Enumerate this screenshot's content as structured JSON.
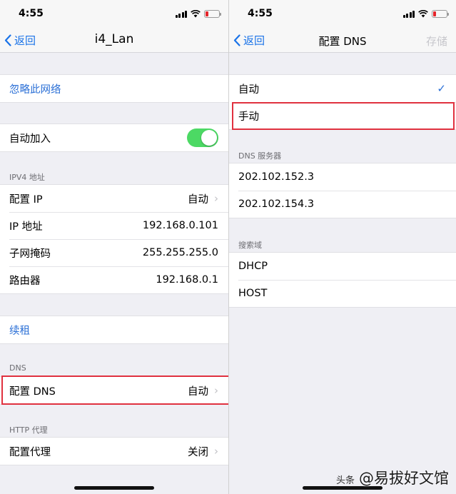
{
  "left": {
    "status": {
      "time": "4:55"
    },
    "nav": {
      "back": "返回",
      "title": "i4_Lan"
    },
    "forget": "忽略此网络",
    "auto_join": {
      "label": "自动加入",
      "on": true
    },
    "ipv4": {
      "header": "IPV4 地址",
      "rows": [
        {
          "label": "配置 IP",
          "value": "自动"
        },
        {
          "label": "IP 地址",
          "value": "192.168.0.101"
        },
        {
          "label": "子网掩码",
          "value": "255.255.255.0"
        },
        {
          "label": "路由器",
          "value": "192.168.0.1"
        }
      ]
    },
    "renew": "续租",
    "dns": {
      "header": "DNS",
      "label": "配置 DNS",
      "value": "自动"
    },
    "proxy": {
      "header": "HTTP 代理",
      "label": "配置代理",
      "value": "关闭"
    }
  },
  "right": {
    "status": {
      "time": "4:55"
    },
    "nav": {
      "back": "返回",
      "title": "配置 DNS",
      "save": "存储"
    },
    "mode": {
      "auto": "自动",
      "manual": "手动"
    },
    "servers": {
      "header": "DNS 服务器",
      "items": [
        "202.102.152.3",
        "202.102.154.3"
      ]
    },
    "search": {
      "header": "搜索域",
      "items": [
        "DHCP",
        "HOST"
      ]
    }
  },
  "watermark": {
    "prefix": "头条",
    "text": "@易拔好文馆"
  },
  "colors": {
    "accent": "#2a6fd6",
    "toggle_on": "#4cd964",
    "highlight": "#e0313f"
  }
}
